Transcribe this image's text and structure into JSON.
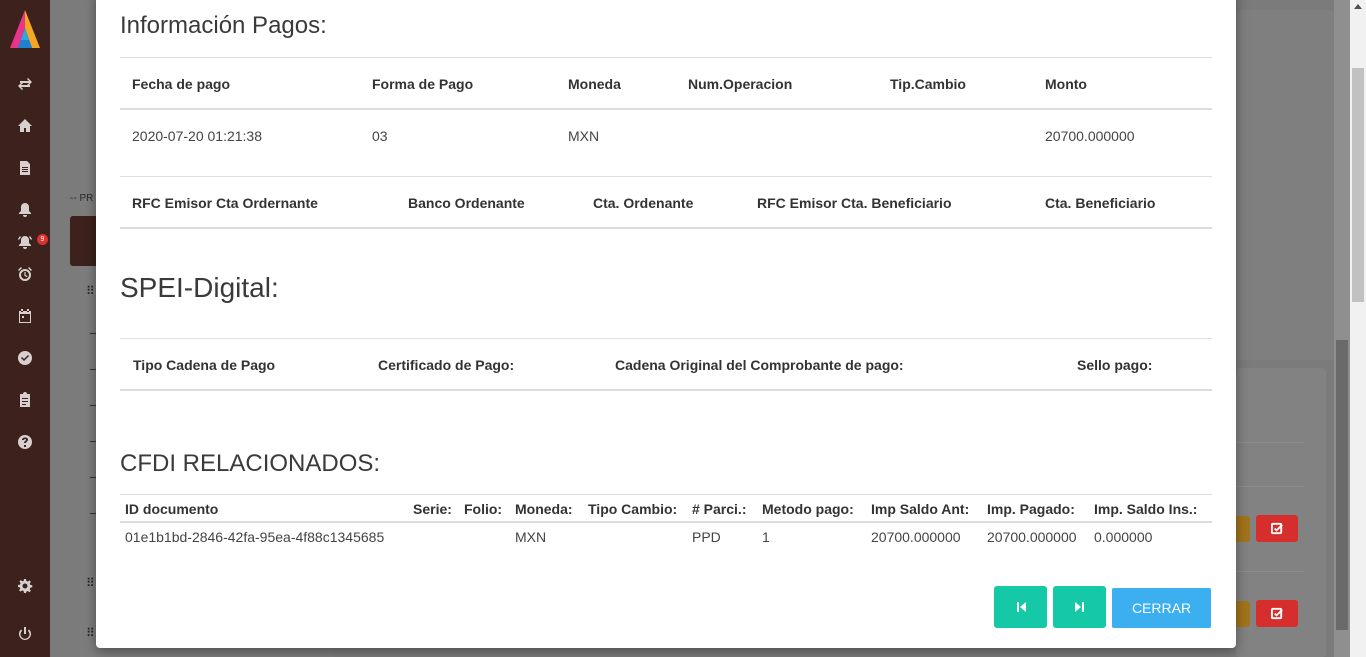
{
  "background": {
    "prev_label": "-- PR",
    "grip_glyph": "⠿"
  },
  "sidebar": {
    "badge_count": "9",
    "icons": [
      "transfer-icon",
      "home-icon",
      "document-icon",
      "bell-icon",
      "bell-alarm-icon",
      "alarm-clock-icon",
      "calendar-icon",
      "check-circle-icon",
      "clipboard-icon",
      "help-icon",
      "settings-icon",
      "power-icon"
    ]
  },
  "pagos": {
    "title": "Información Pagos:",
    "headers": [
      "Fecha de pago",
      "Forma de Pago",
      "Moneda",
      "Num.Operacion",
      "Tip.Cambio",
      "Monto"
    ],
    "row": [
      "2020-07-20 01:21:38",
      "03",
      "MXN",
      "",
      "",
      "20700.000000"
    ],
    "headers2": [
      "RFC Emisor Cta Ordernante",
      "Banco Ordenante",
      "Cta. Ordenante",
      "RFC Emisor Cta. Beneficiario",
      "Cta. Beneficiario"
    ]
  },
  "spei": {
    "title": "SPEI-Digital:",
    "headers": [
      "Tipo Cadena de Pago",
      "Certificado de Pago:",
      "Cadena Original del Comprobante de pago:",
      "Sello pago:"
    ]
  },
  "cfdi": {
    "title": "CFDI RELACIONADOS:",
    "headers": [
      "ID documento",
      "Serie:",
      "Folio:",
      "Moneda:",
      "Tipo Cambio:",
      "# Parci.:",
      "Metodo pago:",
      "Imp Saldo Ant:",
      "Imp. Pagado:",
      "Imp. Saldo Ins.:"
    ],
    "row": [
      "01e1b1bd-2846-42fa-95ea-4f88c1345685",
      "",
      "",
      "MXN",
      "",
      "PPD",
      "1",
      "20700.000000",
      "20700.000000",
      "0.000000"
    ]
  },
  "footer": {
    "close_label": "CERRAR"
  },
  "colors": {
    "sidebar": "#3d211c",
    "teal": "#15c9a7",
    "blue": "#3bafef",
    "red": "#d62d2d",
    "orange": "#a2741b"
  }
}
